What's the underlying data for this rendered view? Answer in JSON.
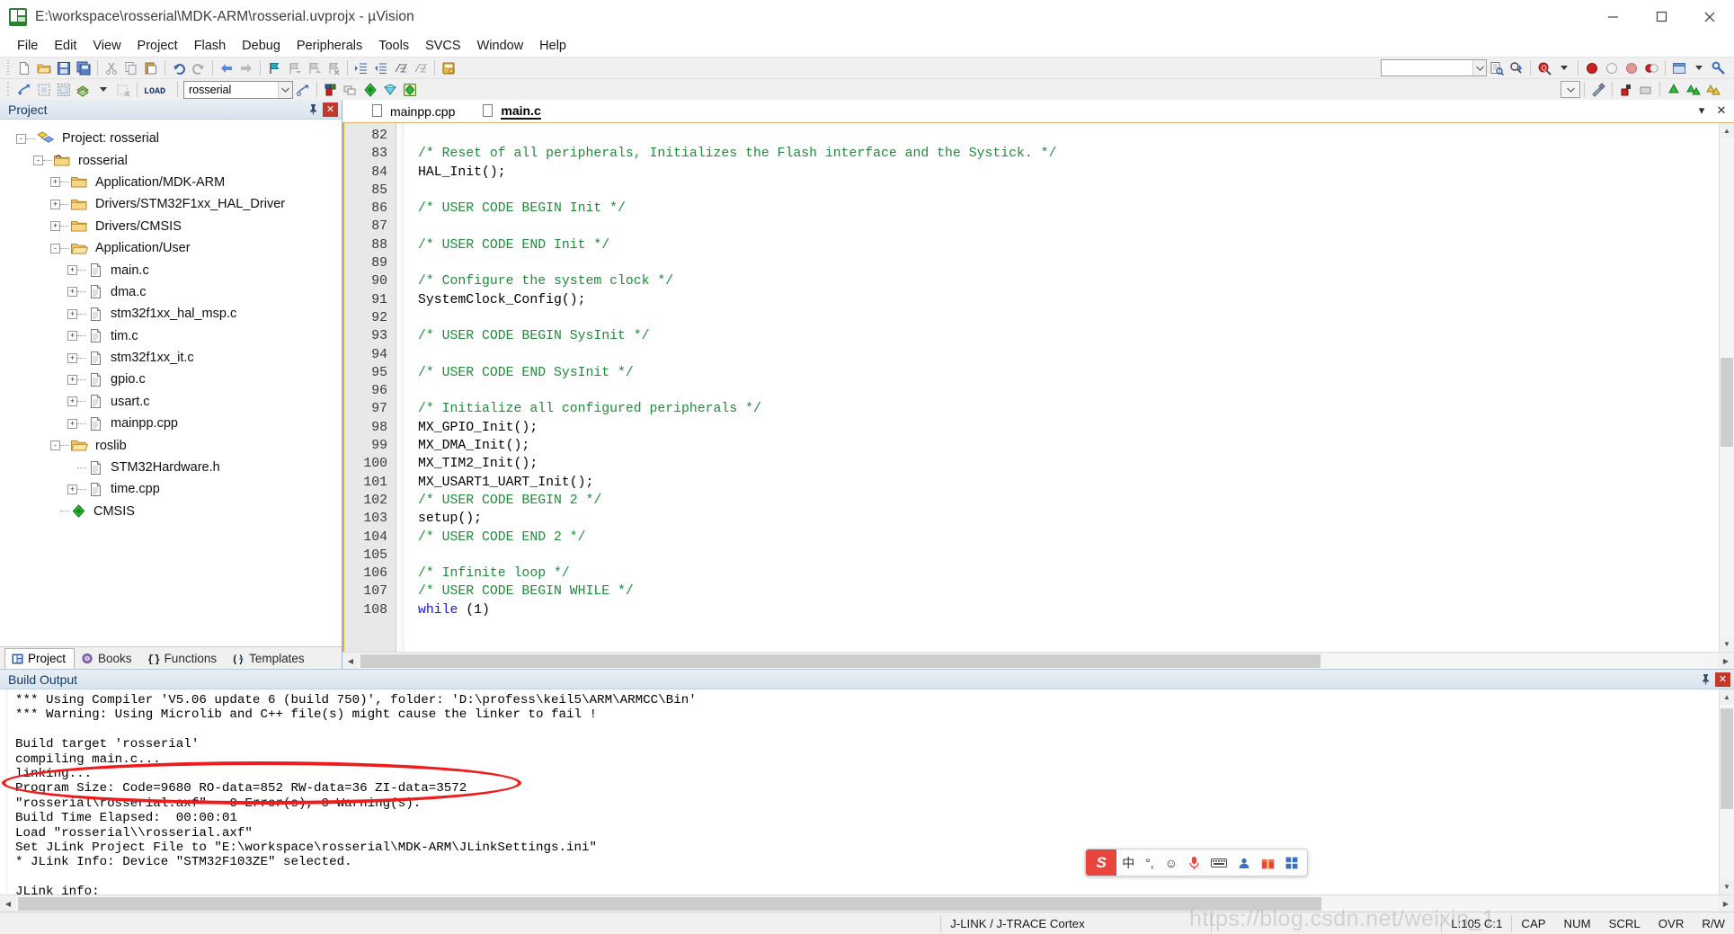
{
  "window": {
    "title": "E:\\workspace\\rosserial\\MDK-ARM\\rosserial.uvprojx - µVision",
    "app_icon": "uvision-icon",
    "minimize": "─",
    "maximize": "☐",
    "close": "✕"
  },
  "menu": [
    "File",
    "Edit",
    "View",
    "Project",
    "Flash",
    "Debug",
    "Peripherals",
    "Tools",
    "SVCS",
    "Window",
    "Help"
  ],
  "toolbar_main": [
    {
      "name": "new-file-icon",
      "glyph": "new"
    },
    {
      "name": "open-file-icon",
      "glyph": "open"
    },
    {
      "name": "save-icon",
      "glyph": "save"
    },
    {
      "name": "save-all-icon",
      "glyph": "saveall"
    },
    {
      "sep": true
    },
    {
      "name": "cut-icon",
      "glyph": "cut"
    },
    {
      "name": "copy-icon",
      "glyph": "copy"
    },
    {
      "name": "paste-icon",
      "glyph": "paste"
    },
    {
      "sep": true
    },
    {
      "name": "undo-icon",
      "glyph": "undo"
    },
    {
      "name": "redo-icon",
      "glyph": "redo"
    },
    {
      "sep": true
    },
    {
      "name": "navigate-back-icon",
      "glyph": "back"
    },
    {
      "name": "navigate-forward-icon",
      "glyph": "forward"
    },
    {
      "sep": true
    },
    {
      "name": "bookmark-toggle-icon",
      "glyph": "bm"
    },
    {
      "name": "bookmark-prev-icon",
      "glyph": "bmp"
    },
    {
      "name": "bookmark-next-icon",
      "glyph": "bmn"
    },
    {
      "name": "bookmark-clear-icon",
      "glyph": "bmc"
    },
    {
      "sep": true
    },
    {
      "name": "indent-icon",
      "glyph": "indent"
    },
    {
      "name": "outdent-icon",
      "glyph": "outdent"
    },
    {
      "name": "comment-icon",
      "glyph": "comment"
    },
    {
      "name": "uncomment-icon",
      "glyph": "uncomment"
    },
    {
      "sep": true
    },
    {
      "name": "configuration-wizard-icon",
      "glyph": "wizard"
    }
  ],
  "toolbar_main_right": [
    {
      "name": "find-combo-input",
      "value": "",
      "placeholder": ""
    },
    {
      "name": "find-in-files-icon",
      "glyph": "findfiles"
    },
    {
      "name": "incremental-find-icon",
      "glyph": "incfind"
    },
    {
      "sep": true
    },
    {
      "name": "find-icon",
      "glyph": "find"
    },
    {
      "name": "find-dropdown-icon",
      "glyph": "caret"
    },
    {
      "sep": true
    },
    {
      "name": "insert-breakpoint-icon",
      "glyph": "bp-red"
    },
    {
      "name": "kill-all-breakpoints-icon",
      "glyph": "bp-hollow"
    },
    {
      "name": "disable-breakpoint-icon",
      "glyph": "bp-gray"
    },
    {
      "name": "enable-disable-breakpoints-icon",
      "glyph": "bp-multi"
    },
    {
      "sep": true
    },
    {
      "name": "manage-windows-icon",
      "glyph": "window"
    },
    {
      "name": "manage-windows-dropdown-icon",
      "glyph": "caret"
    },
    {
      "name": "debug-settings-icon",
      "glyph": "wrench"
    }
  ],
  "toolbar_build": [
    {
      "name": "translate-file-icon",
      "glyph": "translate"
    },
    {
      "name": "build-target-icon",
      "glyph": "build"
    },
    {
      "name": "rebuild-all-icon",
      "glyph": "rebuild"
    },
    {
      "name": "batch-build-icon",
      "glyph": "batch"
    },
    {
      "name": "batch-build-dropdown-icon",
      "glyph": "caret"
    },
    {
      "name": "stop-build-icon",
      "glyph": "stopbuild"
    },
    {
      "sep": true
    },
    {
      "name": "download-to-flash-icon",
      "glyph": "load"
    },
    {
      "sep": true
    }
  ],
  "toolbar_build_target": {
    "name": "target-selector",
    "value": "rosserial"
  },
  "toolbar_build_after_target": [
    {
      "name": "target-options-icon",
      "glyph": "targetopt"
    },
    {
      "sep": true
    },
    {
      "name": "manage-run-time-environment-icon",
      "glyph": "rte"
    },
    {
      "name": "manage-multi-project-icon",
      "glyph": "multiproj"
    },
    {
      "name": "pack-installer-icon",
      "glyph": "pack"
    },
    {
      "name": "select-software-packs-icon",
      "glyph": "softpack"
    },
    {
      "name": "manage-components-icon",
      "glyph": "components"
    }
  ],
  "project_panel": {
    "title": "Project",
    "pin_icon": "pin-icon",
    "close_icon": "close-icon",
    "tree": [
      {
        "depth": 0,
        "expander": "-",
        "icon": "project-icon",
        "label": "Project: rosserial"
      },
      {
        "depth": 1,
        "expander": "-",
        "icon": "target-icon",
        "label": "rosserial"
      },
      {
        "depth": 2,
        "expander": "+",
        "icon": "folder-icon",
        "label": "Application/MDK-ARM"
      },
      {
        "depth": 2,
        "expander": "+",
        "icon": "folder-icon",
        "label": "Drivers/STM32F1xx_HAL_Driver"
      },
      {
        "depth": 2,
        "expander": "+",
        "icon": "folder-icon",
        "label": "Drivers/CMSIS"
      },
      {
        "depth": 2,
        "expander": "-",
        "icon": "folder-open-icon",
        "label": "Application/User"
      },
      {
        "depth": 3,
        "expander": "+",
        "icon": "file-icon",
        "label": "main.c"
      },
      {
        "depth": 3,
        "expander": "+",
        "icon": "file-icon",
        "label": "dma.c"
      },
      {
        "depth": 3,
        "expander": "+",
        "icon": "file-icon",
        "label": "stm32f1xx_hal_msp.c"
      },
      {
        "depth": 3,
        "expander": "+",
        "icon": "file-icon",
        "label": "tim.c"
      },
      {
        "depth": 3,
        "expander": "+",
        "icon": "file-icon",
        "label": "stm32f1xx_it.c"
      },
      {
        "depth": 3,
        "expander": "+",
        "icon": "file-icon",
        "label": "gpio.c"
      },
      {
        "depth": 3,
        "expander": "+",
        "icon": "file-icon",
        "label": "usart.c"
      },
      {
        "depth": 3,
        "expander": "+",
        "icon": "file-icon",
        "label": "mainpp.cpp"
      },
      {
        "depth": 2,
        "expander": "-",
        "icon": "folder-open-icon",
        "label": "roslib"
      },
      {
        "depth": 3,
        "expander": "",
        "icon": "file-icon",
        "label": "STM32Hardware.h"
      },
      {
        "depth": 3,
        "expander": "+",
        "icon": "file-icon",
        "label": "time.cpp"
      },
      {
        "depth": 2,
        "expander": "",
        "icon": "cmsis-icon",
        "label": "CMSIS"
      }
    ],
    "tabs": [
      {
        "label": "Project",
        "icon": "project-tab-icon",
        "active": true
      },
      {
        "label": "Books",
        "icon": "books-tab-icon",
        "active": false
      },
      {
        "label": "Functions",
        "icon": "functions-tab-icon",
        "active": false
      },
      {
        "label": "Templates",
        "icon": "templates-tab-icon",
        "active": false
      }
    ]
  },
  "editor": {
    "tabs": [
      {
        "label": "mainpp.cpp",
        "active": false,
        "icon": "file-icon"
      },
      {
        "label": "main.c",
        "active": true,
        "icon": "file-icon"
      }
    ],
    "tabstrip_buttons": [
      {
        "name": "editor-tab-list-dropdown",
        "glyph": "▾"
      },
      {
        "name": "editor-close-button",
        "glyph": "✕"
      }
    ],
    "first_line": 82,
    "lines": [
      {
        "n": 82,
        "segments": []
      },
      {
        "n": 83,
        "segments": [
          {
            "t": "comment",
            "s": "/* Reset of all peripherals, Initializes the Flash interface and the Systick. */"
          }
        ]
      },
      {
        "n": 84,
        "segments": [
          {
            "t": "plain",
            "s": "HAL_Init();"
          }
        ]
      },
      {
        "n": 85,
        "segments": []
      },
      {
        "n": 86,
        "segments": [
          {
            "t": "comment",
            "s": "/* USER CODE BEGIN Init */"
          }
        ]
      },
      {
        "n": 87,
        "segments": []
      },
      {
        "n": 88,
        "segments": [
          {
            "t": "comment",
            "s": "/* USER CODE END Init */"
          }
        ]
      },
      {
        "n": 89,
        "segments": []
      },
      {
        "n": 90,
        "segments": [
          {
            "t": "comment",
            "s": "/* Configure the system clock */"
          }
        ]
      },
      {
        "n": 91,
        "segments": [
          {
            "t": "plain",
            "s": "SystemClock_Config();"
          }
        ]
      },
      {
        "n": 92,
        "segments": []
      },
      {
        "n": 93,
        "segments": [
          {
            "t": "comment",
            "s": "/* USER CODE BEGIN SysInit */"
          }
        ]
      },
      {
        "n": 94,
        "segments": []
      },
      {
        "n": 95,
        "segments": [
          {
            "t": "comment",
            "s": "/* USER CODE END SysInit */"
          }
        ]
      },
      {
        "n": 96,
        "segments": []
      },
      {
        "n": 97,
        "segments": [
          {
            "t": "comment",
            "s": "/* Initialize all configured peripherals */"
          }
        ]
      },
      {
        "n": 98,
        "segments": [
          {
            "t": "plain",
            "s": "MX_GPIO_Init();"
          }
        ]
      },
      {
        "n": 99,
        "segments": [
          {
            "t": "plain",
            "s": "MX_DMA_Init();"
          }
        ]
      },
      {
        "n": 100,
        "segments": [
          {
            "t": "plain",
            "s": "MX_TIM2_Init();"
          }
        ]
      },
      {
        "n": 101,
        "segments": [
          {
            "t": "plain",
            "s": "MX_USART1_UART_Init();"
          }
        ]
      },
      {
        "n": 102,
        "segments": [
          {
            "t": "comment",
            "s": "/* USER CODE BEGIN 2 */"
          }
        ]
      },
      {
        "n": 103,
        "segments": [
          {
            "t": "plain",
            "s": "setup();"
          }
        ]
      },
      {
        "n": 104,
        "segments": [
          {
            "t": "comment",
            "s": "/* USER CODE END 2 */"
          }
        ]
      },
      {
        "n": 105,
        "segments": []
      },
      {
        "n": 106,
        "segments": [
          {
            "t": "comment",
            "s": "/* Infinite loop */"
          }
        ]
      },
      {
        "n": 107,
        "segments": [
          {
            "t": "comment",
            "s": "/* USER CODE BEGIN WHILE */"
          }
        ]
      },
      {
        "n": 108,
        "segments": [
          {
            "t": "keyword",
            "s": "while"
          },
          {
            "t": "plain",
            "s": " (1)"
          }
        ]
      }
    ]
  },
  "build_output": {
    "title": "Build Output",
    "pin_icon": "pin-icon",
    "close_icon": "close-icon",
    "lines": [
      "*** Using Compiler 'V5.06 update 6 (build 750)', folder: 'D:\\profess\\keil5\\ARM\\ARMCC\\Bin'",
      "*** Warning: Using Microlib and C++ file(s) might cause the linker to fail !",
      "",
      "Build target 'rosserial'",
      "compiling main.c...",
      "linking...",
      "Program Size: Code=9680 RO-data=852 RW-data=36 ZI-data=3572  ",
      "\"rosserial\\rosserial.axf\" - 0 Error(s), 0 Warning(s).",
      "Build Time Elapsed:  00:00:01",
      "Load \"rosserial\\\\rosserial.axf\"",
      "Set JLink Project File to \"E:\\workspace\\rosserial\\MDK-ARM\\JLinkSettings.ini\"",
      "* JLink Info: Device \"STM32F103ZE\" selected.",
      "",
      "JLink info:",
      "------------"
    ],
    "annotation": {
      "name": "red-ellipse-highlight",
      "color": "#ee1c1c"
    }
  },
  "ime_bar": {
    "logo": "S",
    "items": [
      {
        "name": "ime-mode-chinese",
        "glyph": "中"
      },
      {
        "name": "ime-punctuation",
        "glyph": "°,"
      },
      {
        "name": "ime-emoji-icon",
        "glyph": "☺"
      },
      {
        "name": "ime-voice-input-icon",
        "glyph": "🎙"
      },
      {
        "name": "ime-soft-keyboard-icon",
        "glyph": "⌨"
      },
      {
        "name": "ime-user-icon",
        "glyph": "👤"
      },
      {
        "name": "ime-toolbox-icon",
        "glyph": "🎁"
      },
      {
        "name": "ime-apps-icon",
        "glyph": "⬚"
      }
    ]
  },
  "statusbar": {
    "debugger": "J-LINK / J-TRACE Cortex",
    "cursor": "L:105 C:1",
    "indicators": [
      "CAP",
      "NUM",
      "SCRL",
      "OVR",
      "R/W"
    ],
    "watermark": "https://blog.csdn.net/weixin_1"
  },
  "colors": {
    "comment": "#1f8b39",
    "keyword": "#1414d6",
    "annotation_red": "#ee1c1c",
    "active_tab": "#ffd782",
    "inactive_tab": "#c6d2e4",
    "panel_header": "#dae4ee"
  }
}
